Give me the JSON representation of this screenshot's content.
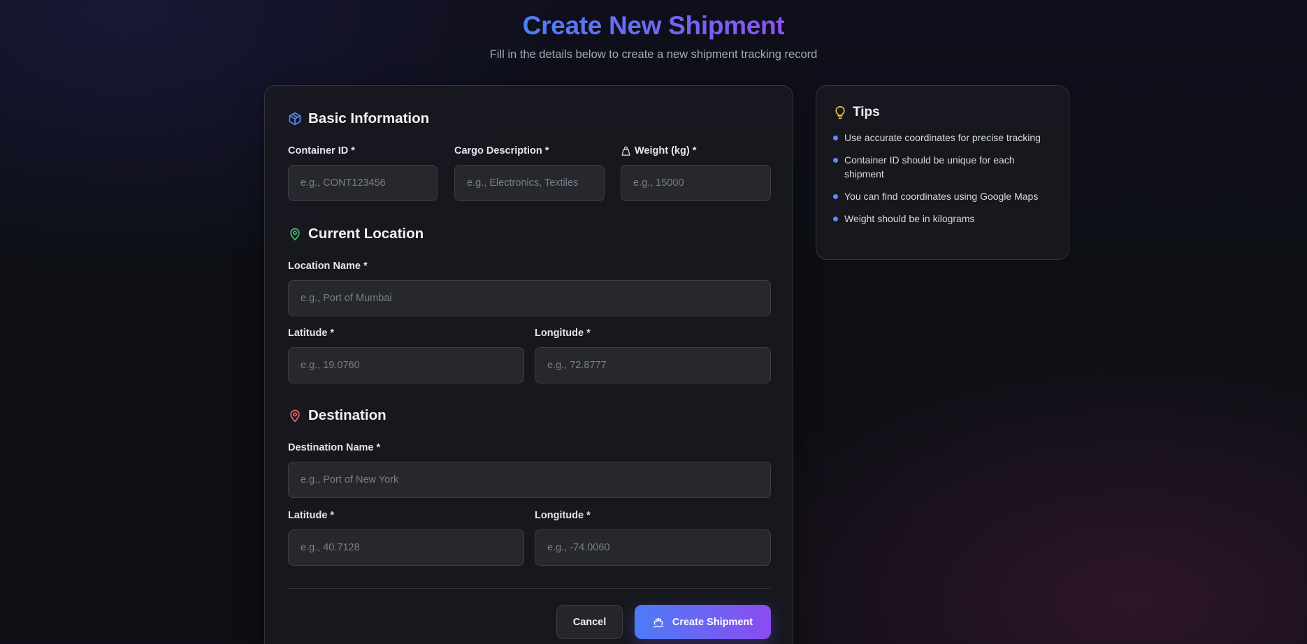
{
  "header": {
    "title": "Create New Shipment",
    "subtitle": "Fill in the details below to create a new shipment tracking record"
  },
  "colors": {
    "title_gradient_start": "#4f7ef7",
    "title_gradient_end": "#8b54f2",
    "basic_icon": "#5b8cf7",
    "location_icon": "#3fbf6f",
    "destination_icon": "#f26b6b",
    "tips_icon": "#f5c542"
  },
  "form": {
    "basic": {
      "title": "Basic Information",
      "icon": "package-icon",
      "container_id": {
        "label": "Container ID *",
        "placeholder": "e.g., CONT123456",
        "value": ""
      },
      "cargo_description": {
        "label": "Cargo Description *",
        "placeholder": "e.g., Electronics, Textiles",
        "value": ""
      },
      "weight": {
        "label": "Weight (kg) *",
        "icon": "weight-icon",
        "placeholder": "e.g., 15000",
        "value": ""
      }
    },
    "current_location": {
      "title": "Current Location",
      "icon": "map-pin-icon",
      "location_name": {
        "label": "Location Name *",
        "placeholder": "e.g., Port of Mumbai",
        "value": ""
      },
      "latitude": {
        "label": "Latitude *",
        "placeholder": "e.g., 19.0760",
        "value": ""
      },
      "longitude": {
        "label": "Longitude *",
        "placeholder": "e.g., 72.8777",
        "value": ""
      }
    },
    "destination": {
      "title": "Destination",
      "icon": "map-pin-icon",
      "destination_name": {
        "label": "Destination Name *",
        "placeholder": "e.g., Port of New York",
        "value": ""
      },
      "latitude": {
        "label": "Latitude *",
        "placeholder": "e.g., 40.7128",
        "value": ""
      },
      "longitude": {
        "label": "Longitude *",
        "placeholder": "e.g., -74.0060",
        "value": ""
      }
    },
    "actions": {
      "cancel_label": "Cancel",
      "create_label": "Create Shipment",
      "create_icon": "ship-icon"
    }
  },
  "tips": {
    "title": "Tips",
    "icon": "lightbulb-icon",
    "items": [
      "Use accurate coordinates for precise tracking",
      "Container ID should be unique for each shipment",
      "You can find coordinates using Google Maps",
      "Weight should be in kilograms"
    ]
  }
}
